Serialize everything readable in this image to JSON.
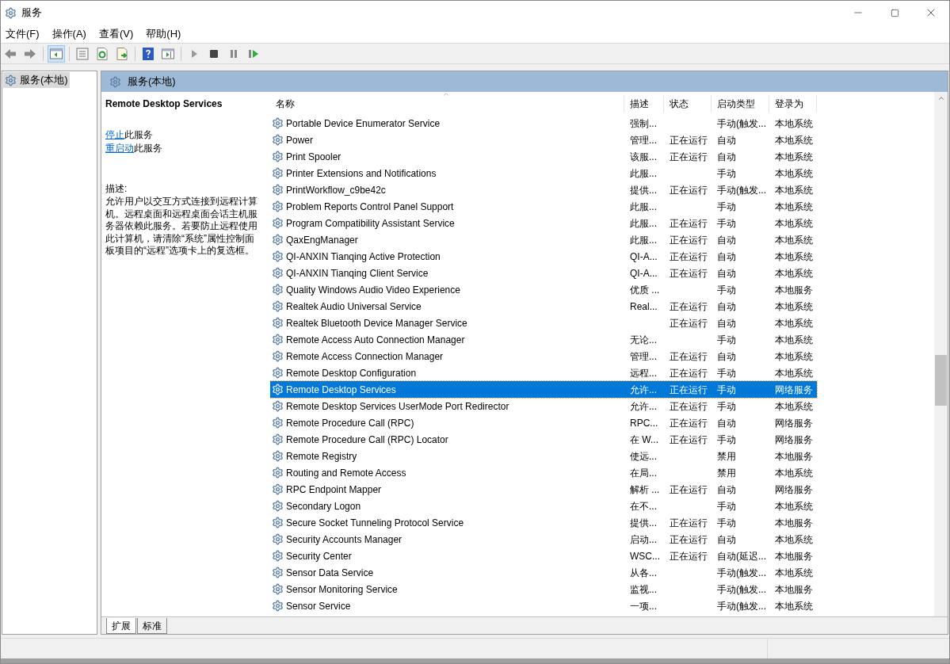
{
  "window": {
    "title": "服务"
  },
  "menu": [
    "文件(F)",
    "操作(A)",
    "查看(V)",
    "帮助(H)"
  ],
  "toolbar": [
    {
      "kind": "back",
      "selected": false
    },
    {
      "kind": "forward",
      "selected": false
    },
    {
      "kind": "tree",
      "selected": true
    },
    {
      "kind": "properties",
      "selected": false
    },
    {
      "kind": "refresh",
      "selected": false
    },
    {
      "kind": "export",
      "selected": false
    },
    {
      "kind": "help",
      "selected": false
    },
    {
      "kind": "actionpane",
      "selected": false
    },
    {
      "kind": "play",
      "selected": false
    },
    {
      "kind": "stop",
      "selected": false
    },
    {
      "kind": "pause",
      "selected": false
    },
    {
      "kind": "resume",
      "selected": false
    }
  ],
  "tree": [
    {
      "label": "服务(本地)",
      "selected": true
    }
  ],
  "pane_title": "服务(本地)",
  "details": {
    "title": "Remote Desktop Services",
    "actions": [
      {
        "link": "停止",
        "text": "此服务"
      },
      {
        "link": "重启动",
        "text": "此服务"
      }
    ],
    "description_label": "描述:",
    "description": "允许用户以交互方式连接到远程计算机。远程桌面和远程桌面会话主机服务器依赖此服务。若要防止远程使用此计算机，请清除“系统”属性控制面板项目的“远程”选项卡上的复选框。"
  },
  "table": {
    "columns": [
      "名称",
      "描述",
      "状态",
      "启动类型",
      "登录为"
    ],
    "rows": [
      {
        "name": "Portable Device Enumerator Service",
        "desc": "强制...",
        "status": "",
        "startup": "手动(触发...",
        "logon": "本地系统",
        "selected": false
      },
      {
        "name": "Power",
        "desc": "管理...",
        "status": "正在运行",
        "startup": "自动",
        "logon": "本地系统",
        "selected": false
      },
      {
        "name": "Print Spooler",
        "desc": "该服...",
        "status": "正在运行",
        "startup": "自动",
        "logon": "本地系统",
        "selected": false
      },
      {
        "name": "Printer Extensions and Notifications",
        "desc": "此服...",
        "status": "",
        "startup": "手动",
        "logon": "本地系统",
        "selected": false
      },
      {
        "name": "PrintWorkflow_c9be42c",
        "desc": "提供...",
        "status": "正在运行",
        "startup": "手动(触发...",
        "logon": "本地系统",
        "selected": false
      },
      {
        "name": "Problem Reports Control Panel Support",
        "desc": "此服...",
        "status": "",
        "startup": "手动",
        "logon": "本地系统",
        "selected": false
      },
      {
        "name": "Program Compatibility Assistant Service",
        "desc": "此服...",
        "status": "正在运行",
        "startup": "手动",
        "logon": "本地系统",
        "selected": false
      },
      {
        "name": "QaxEngManager",
        "desc": "此服...",
        "status": "正在运行",
        "startup": "自动",
        "logon": "本地系统",
        "selected": false
      },
      {
        "name": "QI-ANXIN Tianqing Active Protection",
        "desc": "QI-A...",
        "status": "正在运行",
        "startup": "自动",
        "logon": "本地系统",
        "selected": false
      },
      {
        "name": "QI-ANXIN Tianqing Client Service",
        "desc": "QI-A...",
        "status": "正在运行",
        "startup": "自动",
        "logon": "本地系统",
        "selected": false
      },
      {
        "name": "Quality Windows Audio Video Experience",
        "desc": "优质 ...",
        "status": "",
        "startup": "手动",
        "logon": "本地服务",
        "selected": false
      },
      {
        "name": "Realtek Audio Universal Service",
        "desc": "Real...",
        "status": "正在运行",
        "startup": "自动",
        "logon": "本地系统",
        "selected": false
      },
      {
        "name": "Realtek Bluetooth Device Manager Service",
        "desc": "",
        "status": "正在运行",
        "startup": "自动",
        "logon": "本地系统",
        "selected": false
      },
      {
        "name": "Remote Access Auto Connection Manager",
        "desc": "无论...",
        "status": "",
        "startup": "手动",
        "logon": "本地系统",
        "selected": false
      },
      {
        "name": "Remote Access Connection Manager",
        "desc": "管理...",
        "status": "正在运行",
        "startup": "自动",
        "logon": "本地系统",
        "selected": false
      },
      {
        "name": "Remote Desktop Configuration",
        "desc": "远程...",
        "status": "正在运行",
        "startup": "手动",
        "logon": "本地系统",
        "selected": false
      },
      {
        "name": "Remote Desktop Services",
        "desc": "允许...",
        "status": "正在运行",
        "startup": "手动",
        "logon": "网络服务",
        "selected": true
      },
      {
        "name": "Remote Desktop Services UserMode Port Redirector",
        "desc": "允许...",
        "status": "正在运行",
        "startup": "手动",
        "logon": "本地系统",
        "selected": false
      },
      {
        "name": "Remote Procedure Call (RPC)",
        "desc": "RPC...",
        "status": "正在运行",
        "startup": "自动",
        "logon": "网络服务",
        "selected": false
      },
      {
        "name": "Remote Procedure Call (RPC) Locator",
        "desc": "在 W...",
        "status": "正在运行",
        "startup": "手动",
        "logon": "网络服务",
        "selected": false
      },
      {
        "name": "Remote Registry",
        "desc": "使远...",
        "status": "",
        "startup": "禁用",
        "logon": "本地服务",
        "selected": false
      },
      {
        "name": "Routing and Remote Access",
        "desc": "在局...",
        "status": "",
        "startup": "禁用",
        "logon": "本地系统",
        "selected": false
      },
      {
        "name": "RPC Endpoint Mapper",
        "desc": "解析 ...",
        "status": "正在运行",
        "startup": "自动",
        "logon": "网络服务",
        "selected": false
      },
      {
        "name": "Secondary Logon",
        "desc": "在不...",
        "status": "",
        "startup": "手动",
        "logon": "本地系统",
        "selected": false
      },
      {
        "name": "Secure Socket Tunneling Protocol Service",
        "desc": "提供...",
        "status": "正在运行",
        "startup": "手动",
        "logon": "本地服务",
        "selected": false
      },
      {
        "name": "Security Accounts Manager",
        "desc": "启动...",
        "status": "正在运行",
        "startup": "自动",
        "logon": "本地系统",
        "selected": false
      },
      {
        "name": "Security Center",
        "desc": "WSC...",
        "status": "正在运行",
        "startup": "自动(延迟...",
        "logon": "本地服务",
        "selected": false
      },
      {
        "name": "Sensor Data Service",
        "desc": "从各...",
        "status": "",
        "startup": "手动(触发...",
        "logon": "本地系统",
        "selected": false
      },
      {
        "name": "Sensor Monitoring Service",
        "desc": "监视...",
        "status": "",
        "startup": "手动(触发...",
        "logon": "本地服务",
        "selected": false
      },
      {
        "name": "Sensor Service",
        "desc": "一项...",
        "status": "",
        "startup": "手动(触发...",
        "logon": "本地系统",
        "selected": false
      }
    ]
  },
  "bottom_tabs": [
    {
      "label": "扩展",
      "selected": true
    },
    {
      "label": "标准",
      "selected": false
    }
  ]
}
